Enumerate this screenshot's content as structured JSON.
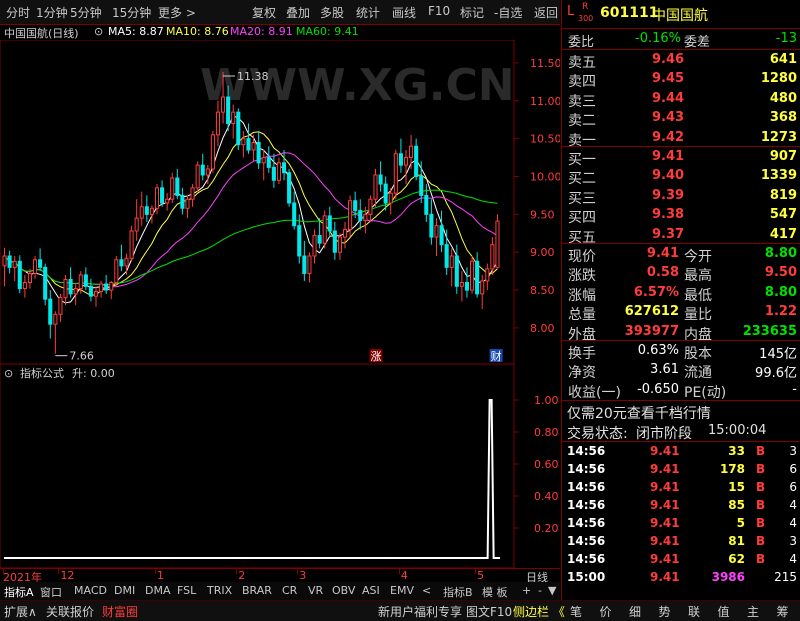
{
  "toolbar": {
    "timeframes": [
      "分时",
      "1分钟",
      "5分钟",
      "15分钟",
      "更多 >"
    ],
    "actions": [
      "复权",
      "叠加",
      "多股",
      "统计",
      "画线",
      "F10",
      "标记",
      "-自选",
      "返回"
    ]
  },
  "chart_title": {
    "stock": "中国国航(日线)",
    "ma5": "MA5: 8.87",
    "ma10": "MA10: 8.76",
    "ma20": "MA20: 8.91",
    "ma60": "MA60: 9.41"
  },
  "watermark": "WWW.XG.CN",
  "colors": {
    "up": "#ff3c3c",
    "down": "#00e8e8",
    "ma5": "#ffffff",
    "ma10": "#ffff40",
    "ma20": "#ff40ff",
    "ma60": "#00e000",
    "frame": "#800000"
  },
  "markers": {
    "high_label": "11.38",
    "low_label": "7.66",
    "rise_badge": "涨",
    "finance_badge": "财"
  },
  "indicator": {
    "title": "指标公式",
    "value": "升: 0.00"
  },
  "chart_data": [
    {
      "type": "candlestick",
      "title": "中国国航(日线)",
      "x_labels": [
        "2021年",
        "12",
        "1",
        "2",
        "3",
        "4",
        "5"
      ],
      "x_label_index": [
        0,
        11,
        30,
        46,
        58,
        78,
        93
      ],
      "ylim": [
        7.55,
        11.75
      ],
      "yticks": [
        8.0,
        8.5,
        9.0,
        9.5,
        10.0,
        10.5,
        11.0,
        11.5
      ],
      "ohlc": [
        [
          8.82,
          9.06,
          8.55,
          8.95
        ],
        [
          8.95,
          9.02,
          8.72,
          8.8
        ],
        [
          8.8,
          8.95,
          8.62,
          8.88
        ],
        [
          8.88,
          8.96,
          8.46,
          8.52
        ],
        [
          8.52,
          8.7,
          8.4,
          8.6
        ],
        [
          8.6,
          8.78,
          8.52,
          8.72
        ],
        [
          8.72,
          8.95,
          8.65,
          8.9
        ],
        [
          8.9,
          9.05,
          8.75,
          8.8
        ],
        [
          8.8,
          8.85,
          8.3,
          8.38
        ],
        [
          8.38,
          8.5,
          7.86,
          8.05
        ],
        [
          8.05,
          8.22,
          7.66,
          8.18
        ],
        [
          8.18,
          8.45,
          8.08,
          8.4
        ],
        [
          8.4,
          8.7,
          8.3,
          8.64
        ],
        [
          8.64,
          8.8,
          8.4,
          8.45
        ],
        [
          8.45,
          8.6,
          8.3,
          8.52
        ],
        [
          8.52,
          8.75,
          8.45,
          8.7
        ],
        [
          8.7,
          8.8,
          8.5,
          8.55
        ],
        [
          8.55,
          8.65,
          8.35,
          8.42
        ],
        [
          8.42,
          8.55,
          8.28,
          8.48
        ],
        [
          8.48,
          8.62,
          8.4,
          8.58
        ],
        [
          8.58,
          8.7,
          8.45,
          8.5
        ],
        [
          8.5,
          8.62,
          8.38,
          8.6
        ],
        [
          8.6,
          8.95,
          8.55,
          8.9
        ],
        [
          8.9,
          9.1,
          8.75,
          8.82
        ],
        [
          8.82,
          8.98,
          8.7,
          8.92
        ],
        [
          8.92,
          9.35,
          8.88,
          9.28
        ],
        [
          9.28,
          9.7,
          9.15,
          9.45
        ],
        [
          9.45,
          9.8,
          9.35,
          9.6
        ],
        [
          9.6,
          9.75,
          9.4,
          9.5
        ],
        [
          9.5,
          9.62,
          9.38,
          9.58
        ],
        [
          9.58,
          9.9,
          9.5,
          9.85
        ],
        [
          9.85,
          9.95,
          9.6,
          9.65
        ],
        [
          9.65,
          9.78,
          9.55,
          9.7
        ],
        [
          9.7,
          10.05,
          9.65,
          9.98
        ],
        [
          9.98,
          10.1,
          9.7,
          9.75
        ],
        [
          9.75,
          9.85,
          9.5,
          9.58
        ],
        [
          9.58,
          9.75,
          9.45,
          9.7
        ],
        [
          9.7,
          9.9,
          9.6,
          9.85
        ],
        [
          9.85,
          10.2,
          9.8,
          10.15
        ],
        [
          10.15,
          10.3,
          9.95,
          10.02
        ],
        [
          10.02,
          10.15,
          9.9,
          10.1
        ],
        [
          10.1,
          10.6,
          10.05,
          10.55
        ],
        [
          10.55,
          11.0,
          10.4,
          10.85
        ],
        [
          10.85,
          11.38,
          10.7,
          11.05
        ],
        [
          11.05,
          11.2,
          10.6,
          10.7
        ],
        [
          10.7,
          10.95,
          10.5,
          10.85
        ],
        [
          10.85,
          10.9,
          10.35,
          10.42
        ],
        [
          10.42,
          10.6,
          10.25,
          10.5
        ],
        [
          10.5,
          10.7,
          10.3,
          10.35
        ],
        [
          10.35,
          10.55,
          10.2,
          10.45
        ],
        [
          10.45,
          10.6,
          10.1,
          10.18
        ],
        [
          10.18,
          10.35,
          9.95,
          10.25
        ],
        [
          10.25,
          10.4,
          10.05,
          10.12
        ],
        [
          10.12,
          10.3,
          9.85,
          9.95
        ],
        [
          9.95,
          10.25,
          9.9,
          10.18
        ],
        [
          10.18,
          10.35,
          9.95,
          10.05
        ],
        [
          10.05,
          10.1,
          9.6,
          9.65
        ],
        [
          9.65,
          9.8,
          9.3,
          9.35
        ],
        [
          9.35,
          9.5,
          8.85,
          8.95
        ],
        [
          8.95,
          9.15,
          8.62,
          8.72
        ],
        [
          8.72,
          9.0,
          8.6,
          8.95
        ],
        [
          8.95,
          9.3,
          8.85,
          9.22
        ],
        [
          9.22,
          9.45,
          9.05,
          9.12
        ],
        [
          9.12,
          9.55,
          9.05,
          9.48
        ],
        [
          9.48,
          9.6,
          9.2,
          9.28
        ],
        [
          9.28,
          9.4,
          8.9,
          9.0
        ],
        [
          9.0,
          9.25,
          8.9,
          9.2
        ],
        [
          9.2,
          9.4,
          9.05,
          9.3
        ],
        [
          9.3,
          9.75,
          9.2,
          9.68
        ],
        [
          9.68,
          9.8,
          9.45,
          9.55
        ],
        [
          9.55,
          9.7,
          9.3,
          9.42
        ],
        [
          9.42,
          9.6,
          9.25,
          9.5
        ],
        [
          9.5,
          9.75,
          9.4,
          9.7
        ],
        [
          9.7,
          10.1,
          9.6,
          10.02
        ],
        [
          10.02,
          10.2,
          9.8,
          9.9
        ],
        [
          9.9,
          10.0,
          9.55,
          9.65
        ],
        [
          9.65,
          9.85,
          9.5,
          9.78
        ],
        [
          9.78,
          10.35,
          9.7,
          10.3
        ],
        [
          10.3,
          10.5,
          10.05,
          10.15
        ],
        [
          10.15,
          10.35,
          9.9,
          10.25
        ],
        [
          10.25,
          10.55,
          10.1,
          10.4
        ],
        [
          10.4,
          10.5,
          9.95,
          10.0
        ],
        [
          10.0,
          10.2,
          9.65,
          9.75
        ],
        [
          9.75,
          9.9,
          9.4,
          9.5
        ],
        [
          9.5,
          9.7,
          9.1,
          9.2
        ],
        [
          9.2,
          9.45,
          8.95,
          9.35
        ],
        [
          9.35,
          9.55,
          9.0,
          9.1
        ],
        [
          9.1,
          9.3,
          8.7,
          8.8
        ],
        [
          8.8,
          9.05,
          8.55,
          8.95
        ],
        [
          8.95,
          9.1,
          8.45,
          8.55
        ],
        [
          8.55,
          8.75,
          8.35,
          8.6
        ],
        [
          8.6,
          8.8,
          8.4,
          8.5
        ],
        [
          8.5,
          8.95,
          8.45,
          8.88
        ],
        [
          8.88,
          9.0,
          8.4,
          8.45
        ],
        [
          8.45,
          8.7,
          8.25,
          8.62
        ],
        [
          8.62,
          8.85,
          8.5,
          8.78
        ],
        [
          8.78,
          9.2,
          8.7,
          9.1
        ],
        [
          8.8,
          9.5,
          8.8,
          9.41
        ]
      ],
      "x_badge_index": {
        "rise": 73,
        "finance": 99
      }
    },
    {
      "type": "line",
      "title": "指标公式",
      "ylim": [
        0,
        1.1
      ],
      "yticks": [
        0.2,
        0.4,
        0.6,
        0.8,
        1.0
      ],
      "spike_index": 99,
      "spike_value": 1.0
    }
  ],
  "axis_right_label": "日线",
  "tabs": [
    "指标A",
    "窗口",
    "MACD",
    "DMI",
    "DMA",
    "FSL",
    "TRIX",
    "BRAR",
    "CR",
    "VR",
    "OBV",
    "ASI",
    "EMV",
    "<",
    "指标B",
    "模 板",
    "+",
    "-",
    "▼"
  ],
  "bottom": {
    "left": [
      "扩展∧",
      "关联报价",
      "财富圈"
    ],
    "promo": [
      "新用户福利专享",
      "图文F10",
      "侧边栏 《"
    ],
    "right_tabs": [
      "笔",
      "价",
      "细",
      "势",
      "联",
      "值",
      "主",
      "筹"
    ]
  },
  "quote": {
    "flag_l": "L",
    "flag_r": "R",
    "flag_num": "300",
    "code": "601111",
    "name": "中国国航",
    "webi_label": "委比",
    "webi_value": "-0.16%",
    "weicha_label": "委差",
    "weicha_value": "-13",
    "asks": [
      {
        "label": "卖五",
        "price": "9.46",
        "vol": "641"
      },
      {
        "label": "卖四",
        "price": "9.45",
        "vol": "1280"
      },
      {
        "label": "卖三",
        "price": "9.44",
        "vol": "480"
      },
      {
        "label": "卖二",
        "price": "9.43",
        "vol": "368"
      },
      {
        "label": "卖一",
        "price": "9.42",
        "vol": "1273"
      }
    ],
    "bids": [
      {
        "label": "买一",
        "price": "9.41",
        "vol": "907"
      },
      {
        "label": "买二",
        "price": "9.40",
        "vol": "1339"
      },
      {
        "label": "买三",
        "price": "9.39",
        "vol": "819"
      },
      {
        "label": "买四",
        "price": "9.38",
        "vol": "547"
      },
      {
        "label": "买五",
        "price": "9.37",
        "vol": "417"
      }
    ],
    "stats": [
      {
        "l1": "现价",
        "v1": "9.41",
        "c1": "red",
        "l2": "今开",
        "v2": "8.80",
        "c2": "grn"
      },
      {
        "l1": "涨跌",
        "v1": "0.58",
        "c1": "red",
        "l2": "最高",
        "v2": "9.50",
        "c2": "red"
      },
      {
        "l1": "涨幅",
        "v1": "6.57%",
        "c1": "red",
        "l2": "最低",
        "v2": "8.80",
        "c2": "grn"
      },
      {
        "l1": "总量",
        "v1": "627612",
        "c1": "yel",
        "l2": "量比",
        "v2": "1.22",
        "c2": "red"
      },
      {
        "l1": "外盘",
        "v1": "393977",
        "c1": "red",
        "l2": "内盘",
        "v2": "233635",
        "c2": "grn"
      }
    ],
    "fin": [
      {
        "l1": "换手",
        "v1": "0.63%",
        "l2": "股本",
        "v2": "145亿"
      },
      {
        "l1": "净资",
        "v1": "3.61",
        "l2": "流通",
        "v2": "99.6亿"
      },
      {
        "l1": "收益(一)",
        "v1": "-0.650",
        "l2": "PE(动)",
        "v2": "-"
      }
    ],
    "promo": "仅需20元查看千档行情",
    "status_label": "交易状态:",
    "status_value": "闭市阶段",
    "status_time": "15:00:04",
    "trades": [
      {
        "time": "14:56",
        "price": "9.41",
        "vol": "33",
        "side": "B",
        "n": "3"
      },
      {
        "time": "14:56",
        "price": "9.41",
        "vol": "178",
        "side": "B",
        "n": "6"
      },
      {
        "time": "14:56",
        "price": "9.41",
        "vol": "15",
        "side": "B",
        "n": "6"
      },
      {
        "time": "14:56",
        "price": "9.41",
        "vol": "85",
        "side": "B",
        "n": "4"
      },
      {
        "time": "14:56",
        "price": "9.41",
        "vol": "5",
        "side": "B",
        "n": "4"
      },
      {
        "time": "14:56",
        "price": "9.41",
        "vol": "81",
        "side": "B",
        "n": "3"
      },
      {
        "time": "14:56",
        "price": "9.41",
        "vol": "62",
        "side": "B",
        "n": "4"
      },
      {
        "time": "15:00",
        "price": "9.41",
        "vol": "3986",
        "side": "",
        "n": "215"
      }
    ]
  }
}
